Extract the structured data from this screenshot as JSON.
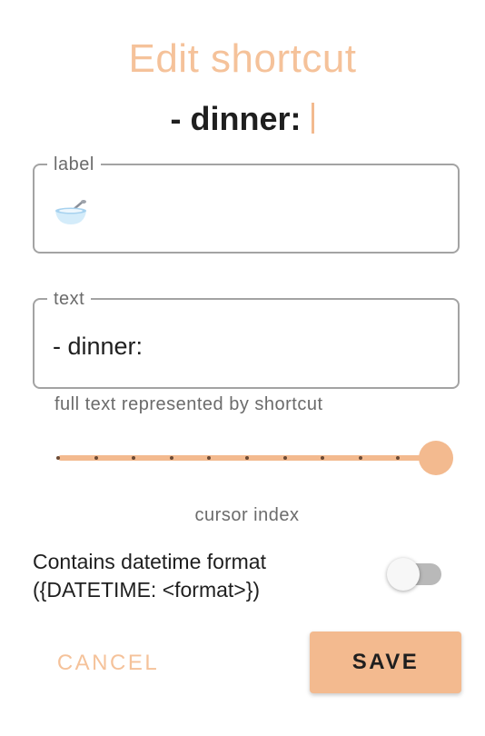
{
  "dialog": {
    "title": "Edit shortcut",
    "preview_text": "- dinner:"
  },
  "label_field": {
    "legend": "label",
    "value_icon": "bowl-with-spoon-icon"
  },
  "text_field": {
    "legend": "text",
    "value": "- dinner:",
    "helper": "full text represented by shortcut"
  },
  "cursor_slider": {
    "caption": "cursor index",
    "steps": 10,
    "value": 10
  },
  "datetime_toggle": {
    "label": "Contains datetime format ({DATETIME: <format>})",
    "enabled": false
  },
  "actions": {
    "cancel_label": "CANCEL",
    "save_label": "SAVE"
  },
  "colors": {
    "accent": "#f3ba8f",
    "title": "#f5c29a",
    "outline": "#a3a3a3",
    "switch_track_off": "#b9b9b9"
  }
}
